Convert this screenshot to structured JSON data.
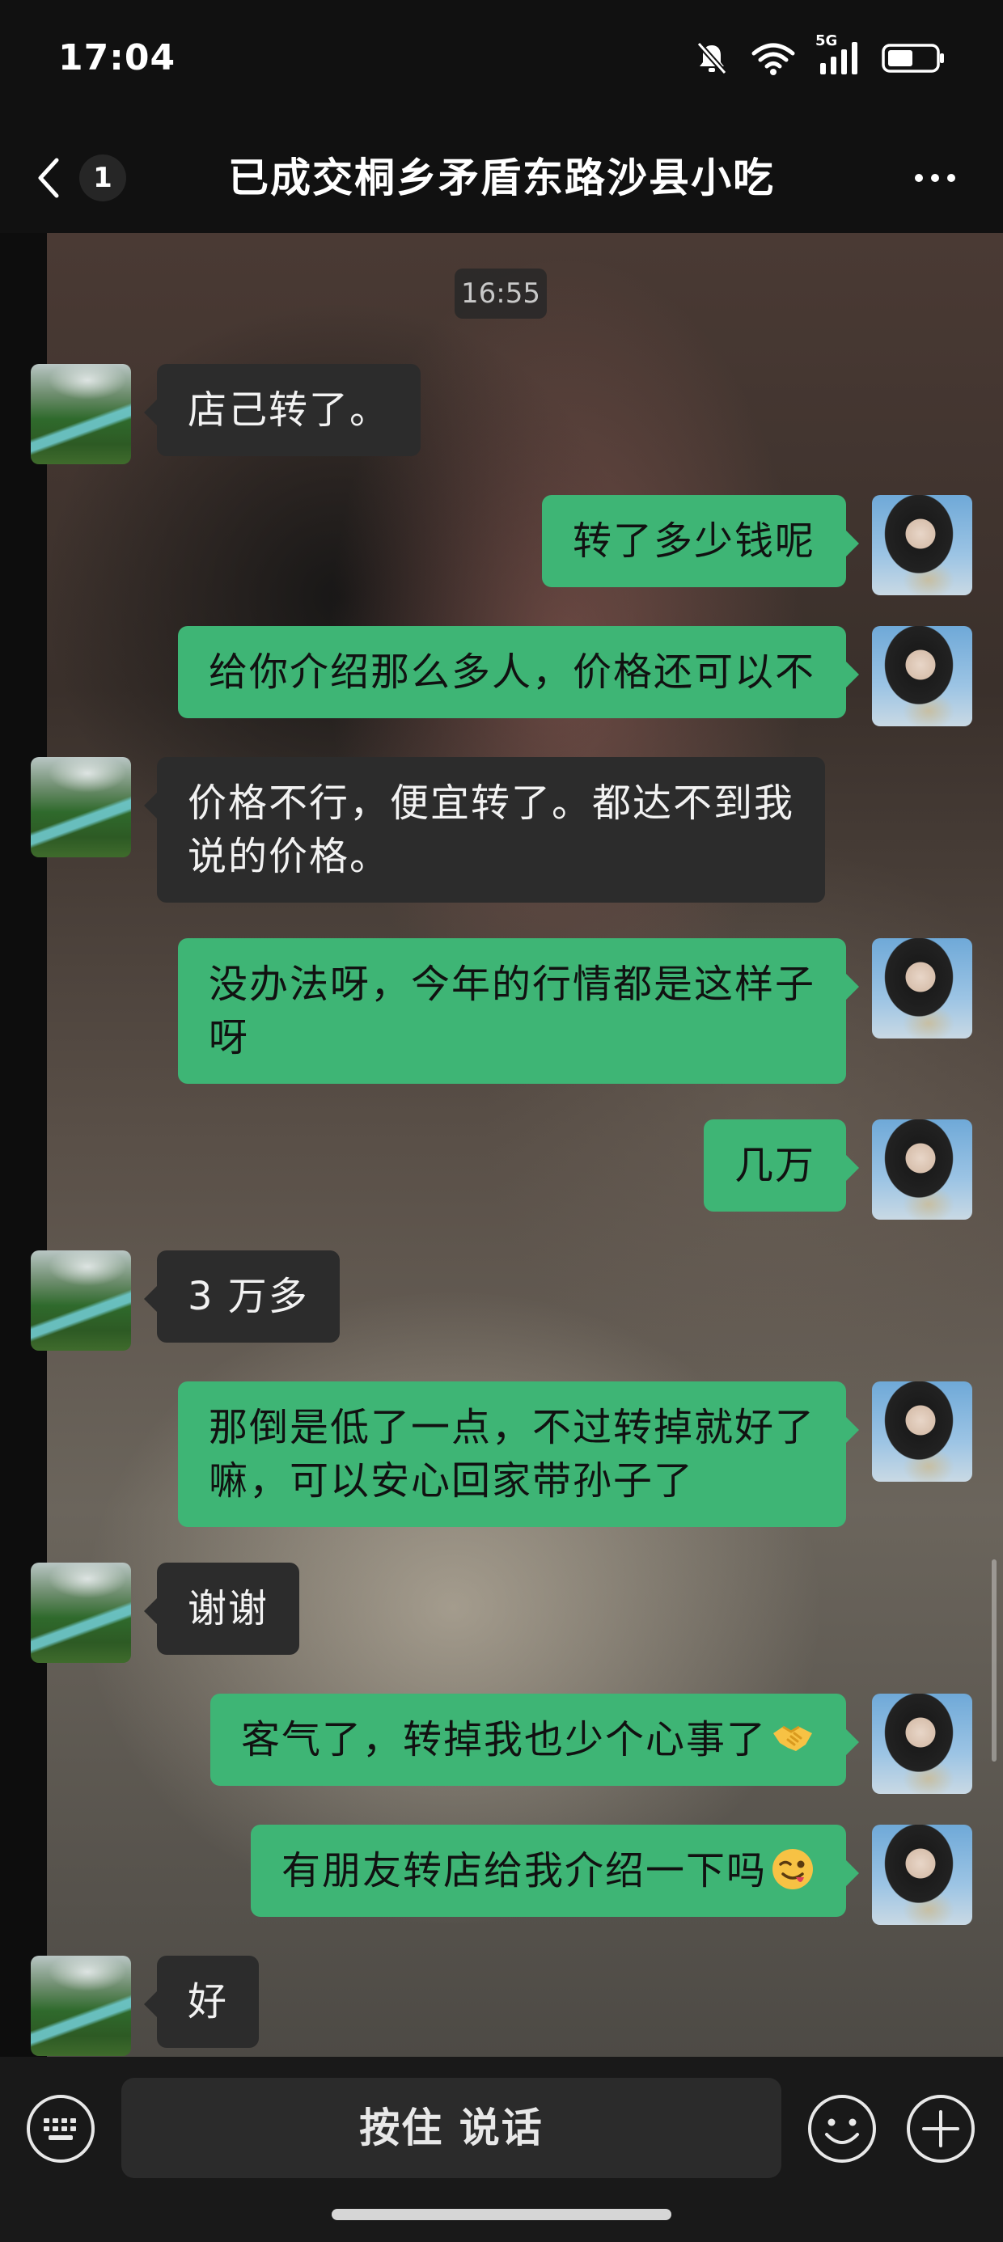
{
  "status_bar": {
    "time": "17:04",
    "network": "5G"
  },
  "nav": {
    "unread_count": "1",
    "title": "已成交桐乡矛盾东路沙县小吃"
  },
  "chat": {
    "timestamp": "16:55",
    "messages": [
      {
        "side": "in",
        "text": "店己转了。"
      },
      {
        "side": "out",
        "text": "转了多少钱呢"
      },
      {
        "side": "out",
        "text": "给你介绍那么多人，价格还可以不"
      },
      {
        "side": "in",
        "text": "价格不行，便宜转了。都达不到我\n说的价格。"
      },
      {
        "side": "out",
        "text": "没办法呀，今年的行情都是这样子\n呀"
      },
      {
        "side": "out",
        "text": "几万"
      },
      {
        "side": "in",
        "text": "3 万多"
      },
      {
        "side": "out",
        "text": "那倒是低了一点，不过转掉就好了\n嘛，可以安心回家带孙子了"
      },
      {
        "side": "in",
        "text": "谢谢"
      },
      {
        "side": "out",
        "text": "客气了，转掉我也少个心事了",
        "emoji": "handshake"
      },
      {
        "side": "out",
        "text": "有朋友转店给我介绍一下吗",
        "emoji": "winking-face"
      },
      {
        "side": "in",
        "text": "好"
      }
    ]
  },
  "input_bar": {
    "hold_to_talk_label": "按住 说话"
  }
}
